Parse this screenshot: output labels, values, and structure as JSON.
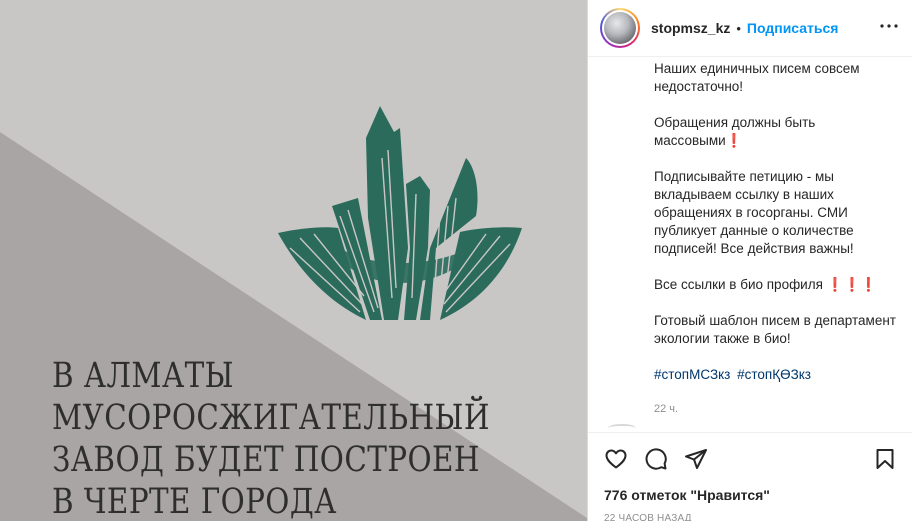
{
  "post_image": {
    "headline_lines": [
      "В АЛМАТЫ",
      "МУСОРОСЖИГАТЕЛЬНЫЙ",
      "ЗАВОД БУДЕТ ПОСТРОЕН",
      "В ЧЕРТЕ ГОРОДА"
    ],
    "colors": {
      "background": "#c9c7c5",
      "triangle": "#a8a4a3",
      "logo": "#2b6b5c",
      "text": "#2e2e2e"
    }
  },
  "header": {
    "username": "stopmsz_kz",
    "separator": "•",
    "follow_label": "Подписаться",
    "more_icon": "more-horizontal-icon"
  },
  "caption": {
    "paragraphs": [
      "Наших единичных писем совсем недостаточно!",
      "Обращения должны быть массовыми❗",
      "Подписывайте петицию - мы вкладываем ссылку в наших обращениях в госорганы. СМИ публикует данные о количестве подписей! Все действия важны!",
      "Все ссылки в био профиля ❗❗❗",
      "Готовый шаблон писем в департамент экологии также в био!"
    ],
    "hashtags": [
      "#стопМСЗкз",
      "#стопҚӨЗкз"
    ],
    "time": "22 ч."
  },
  "actions": {
    "icons": [
      "heart-icon",
      "comment-icon",
      "share-icon",
      "bookmark-icon"
    ],
    "likes": "776 отметок \"Нравится\"",
    "posted_ago": "22 ЧАСОВ НАЗАД"
  },
  "colors": {
    "accent": "#0095f6",
    "hashtag": "#00376b",
    "muted": "#8e8e8e"
  }
}
